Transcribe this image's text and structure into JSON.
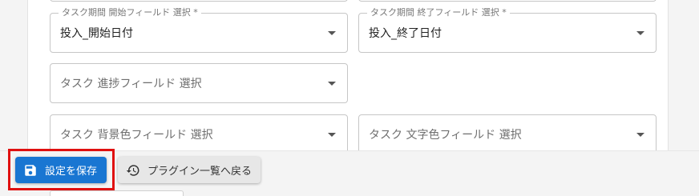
{
  "fields": {
    "start_field": {
      "label": "タスク期間 開始フィールド 選択 *",
      "value": "投入_開始日付"
    },
    "end_field": {
      "label": "タスク期間 終了フィールド 選択 *",
      "value": "投入_終了日付"
    },
    "progress_field": {
      "placeholder": "タスク 進捗フィールド 選択"
    },
    "bg_color_field": {
      "placeholder": "タスク 背景色フィールド 選択"
    },
    "text_color_field": {
      "placeholder": "タスク 文字色フィールド 選択"
    }
  },
  "footer": {
    "save_label": "設定を保存",
    "back_label": "プラグイン一覧へ戻る"
  },
  "colors": {
    "primary": "#1976d2",
    "highlight": "#e01010"
  }
}
